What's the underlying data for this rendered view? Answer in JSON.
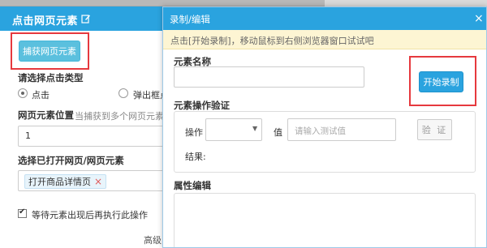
{
  "left_panel": {
    "title": "点击网页元素",
    "capture_button": "捕获网页元素",
    "click_type_label": "请选择点击类型",
    "radio_click": "点击",
    "radio_popup": "弹出框点",
    "position_label": "网页元素位置",
    "position_hint": "当捕获到多个网页元素时,",
    "position_value": "1",
    "open_page_label": "选择已打开网页/网页元素",
    "open_page_tag": "打开商品详情页",
    "open_page_tag_remove": "×",
    "wait_checkbox_label": "等待元素出现后再执行此操作",
    "wait_checked": true,
    "advanced_label": "高级"
  },
  "dialog": {
    "title": "录制/编辑",
    "close": "×",
    "tip": "点击[开始录制]，移动鼠标到右侧浏览器窗口试试吧",
    "element_name_label": "元素名称",
    "element_name_value": "",
    "record_button": "开始录制",
    "verify_section_label": "元素操作验证",
    "operation_label": "操作",
    "value_label": "值",
    "value_placeholder": "请输入测试值",
    "verify_button": "验 证",
    "result_label": "结果:",
    "attr_edit_label": "属性编辑"
  },
  "colors": {
    "header_blue": "#2aa3df",
    "capture_button": "#5bc0de",
    "highlight_red": "#e6393e",
    "tip_background": "#fdf5d3"
  }
}
